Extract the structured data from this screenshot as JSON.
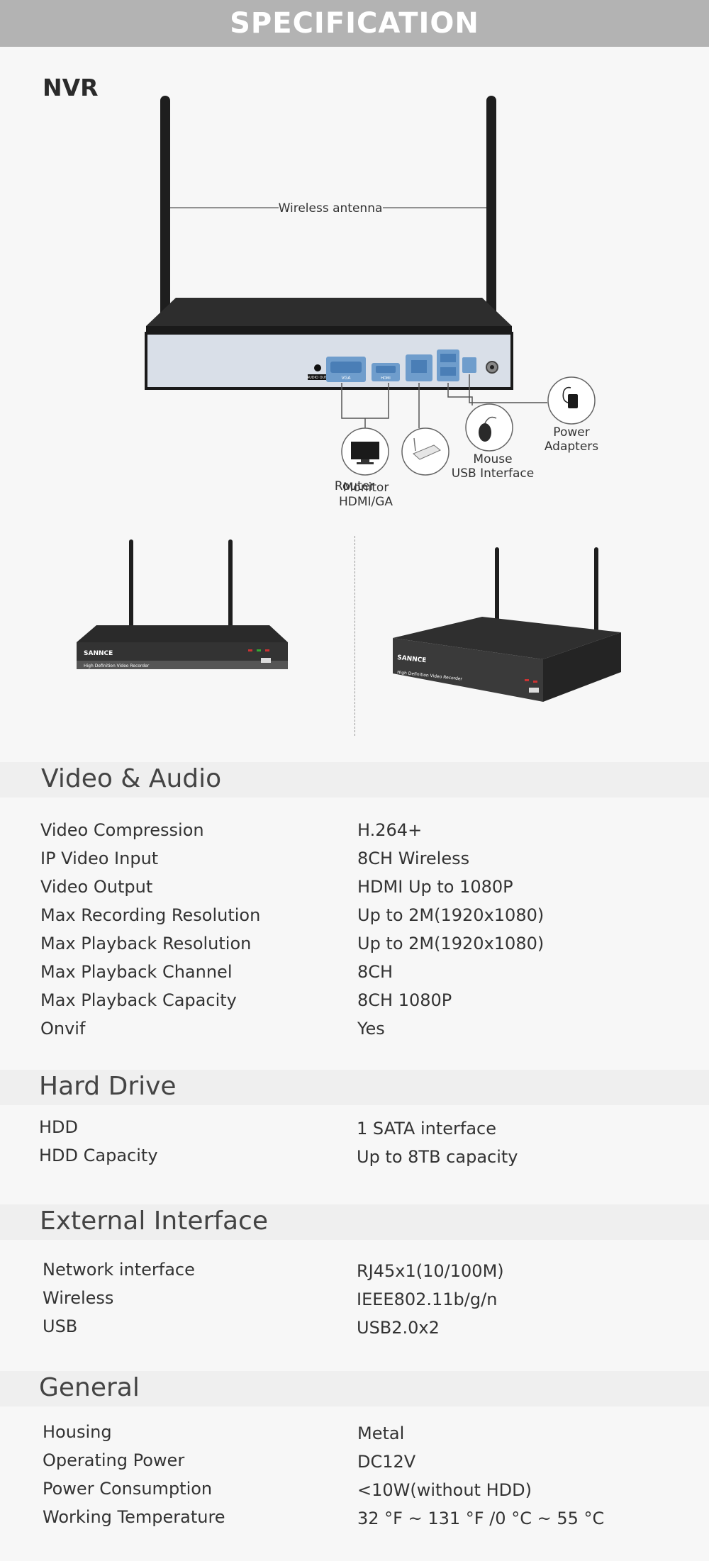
{
  "banner_title": "SPECIFICATION",
  "nvr_title": "NVR",
  "diagram_labels": {
    "antenna": "Wireless antenna",
    "power_1": "Power",
    "power_2": "Adapters",
    "mouse_1": "Mouse",
    "mouse_2": "USB Interface",
    "router": "Router",
    "monitor_1": "Monitor",
    "monitor_2": "HDMI/GA",
    "port_audio": "AUDIO OUT",
    "port_vga": "VGA",
    "port_hdmi": "HDMI",
    "brand": "SANNCE",
    "product_line": "High Definition Video Recorder"
  },
  "sections": {
    "video_audio": {
      "title": "Video & Audio",
      "rows": [
        {
          "label": "Video Compression",
          "value": "H.264+"
        },
        {
          "label": "IP Video Input",
          "value": "8CH Wireless"
        },
        {
          "label": "Video Output",
          "value": "HDMI  Up to 1080P"
        },
        {
          "label": "Max Recording Resolution",
          "value": "Up to 2M(1920x1080)"
        },
        {
          "label": "Max Playback Resolution",
          "value": "Up to 2M(1920x1080)"
        },
        {
          "label": "Max Playback Channel",
          "value": "8CH"
        },
        {
          "label": "Max Playback Capacity",
          "value": "8CH 1080P"
        },
        {
          "label": "Onvif",
          "value": "Yes"
        }
      ]
    },
    "hard_drive": {
      "title": "Hard Drive",
      "rows": [
        {
          "label": "HDD",
          "value": "1 SATA interface"
        },
        {
          "label": "HDD Capacity",
          "value": "Up to 8TB capacity"
        }
      ]
    },
    "external_interface": {
      "title": "External Interface",
      "rows": [
        {
          "label": "Network interface",
          "value": "RJ45x1(10/100M)"
        },
        {
          "label": "Wireless",
          "value": "IEEE802.11b/g/n"
        },
        {
          "label": "USB",
          "value": "USB2.0x2"
        }
      ]
    },
    "general": {
      "title": "General",
      "rows": [
        {
          "label": "Housing",
          "value": "Metal"
        },
        {
          "label": "Operating Power",
          "value": "DC12V"
        },
        {
          "label": "Power Consumption",
          "value": "<10W(without HDD)"
        },
        {
          "label": "Working Temperature",
          "value": "32 °F ~ 131 °F /0 °C ~ 55 °C"
        }
      ]
    }
  },
  "colors": {
    "banner": "#b3b3b3",
    "section_bar": "#efefef",
    "page": "#f7f7f7",
    "device_body": "#2a2a2a",
    "device_panel": "#d9dfe8"
  }
}
